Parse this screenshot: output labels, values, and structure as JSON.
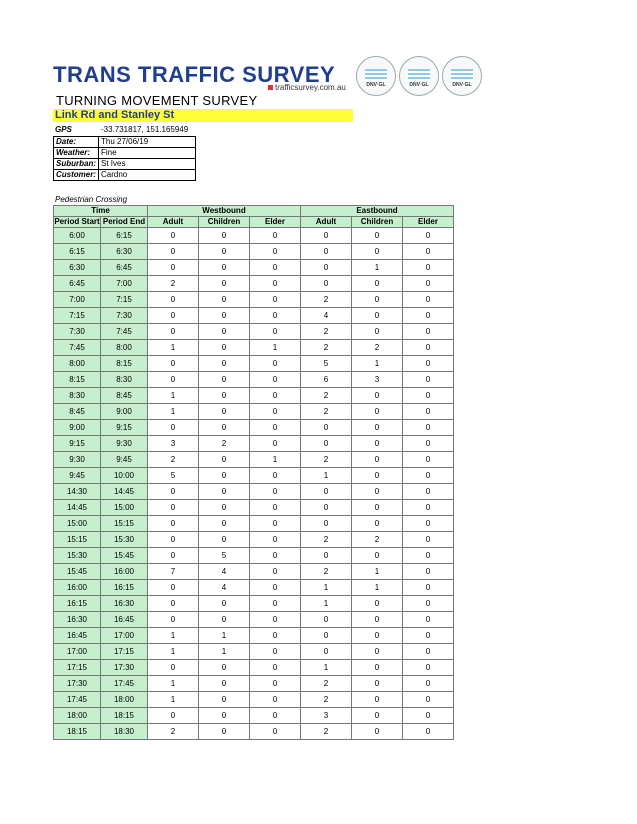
{
  "header": {
    "logo_text": "TRANS TRAFFIC SURVEY",
    "website": "trafficsurvey.com.au",
    "badges": [
      {
        "label": "DNV·GL",
        "sublabel": "ISO 9001"
      },
      {
        "label": "DNV·GL",
        "sublabel": "ISO 45001"
      },
      {
        "label": "DNV·GL",
        "sublabel": "ISO 14001"
      }
    ],
    "report_title": "TURNING MOVEMENT SURVEY",
    "location": "Link Rd and Stanley St"
  },
  "gps": {
    "label": "GPS",
    "value": "-33.731817, 151.165949"
  },
  "info": [
    {
      "label": "Date:",
      "value": "Thu 27/06/19"
    },
    {
      "label": "Weather:",
      "value": "Fine"
    },
    {
      "label": "Suburban:",
      "value": "St Ives"
    },
    {
      "label": "Customer:",
      "value": "Cardno"
    }
  ],
  "section_label": "Pedestrian Crossing",
  "table": {
    "group_headers": {
      "time": "Time",
      "westbound": "Westbound",
      "eastbound": "Eastbound"
    },
    "columns": [
      "Period Start",
      "Period End",
      "Adult",
      "Children",
      "Elder",
      "Adult",
      "Children",
      "Elder"
    ],
    "rows": [
      [
        "6:00",
        "6:15",
        "0",
        "0",
        "0",
        "0",
        "0",
        "0"
      ],
      [
        "6:15",
        "6:30",
        "0",
        "0",
        "0",
        "0",
        "0",
        "0"
      ],
      [
        "6:30",
        "6:45",
        "0",
        "0",
        "0",
        "0",
        "1",
        "0"
      ],
      [
        "6:45",
        "7:00",
        "2",
        "0",
        "0",
        "0",
        "0",
        "0"
      ],
      [
        "7:00",
        "7:15",
        "0",
        "0",
        "0",
        "2",
        "0",
        "0"
      ],
      [
        "7:15",
        "7:30",
        "0",
        "0",
        "0",
        "4",
        "0",
        "0"
      ],
      [
        "7:30",
        "7:45",
        "0",
        "0",
        "0",
        "2",
        "0",
        "0"
      ],
      [
        "7:45",
        "8:00",
        "1",
        "0",
        "1",
        "2",
        "2",
        "0"
      ],
      [
        "8:00",
        "8:15",
        "0",
        "0",
        "0",
        "5",
        "1",
        "0"
      ],
      [
        "8:15",
        "8:30",
        "0",
        "0",
        "0",
        "6",
        "3",
        "0"
      ],
      [
        "8:30",
        "8:45",
        "1",
        "0",
        "0",
        "2",
        "0",
        "0"
      ],
      [
        "8:45",
        "9:00",
        "1",
        "0",
        "0",
        "2",
        "0",
        "0"
      ],
      [
        "9:00",
        "9:15",
        "0",
        "0",
        "0",
        "0",
        "0",
        "0"
      ],
      [
        "9:15",
        "9:30",
        "3",
        "2",
        "0",
        "0",
        "0",
        "0"
      ],
      [
        "9:30",
        "9:45",
        "2",
        "0",
        "1",
        "2",
        "0",
        "0"
      ],
      [
        "9:45",
        "10:00",
        "5",
        "0",
        "0",
        "1",
        "0",
        "0"
      ],
      [
        "14:30",
        "14:45",
        "0",
        "0",
        "0",
        "0",
        "0",
        "0"
      ],
      [
        "14:45",
        "15:00",
        "0",
        "0",
        "0",
        "0",
        "0",
        "0"
      ],
      [
        "15:00",
        "15:15",
        "0",
        "0",
        "0",
        "0",
        "0",
        "0"
      ],
      [
        "15:15",
        "15:30",
        "0",
        "0",
        "0",
        "2",
        "2",
        "0"
      ],
      [
        "15:30",
        "15:45",
        "0",
        "5",
        "0",
        "0",
        "0",
        "0"
      ],
      [
        "15:45",
        "16:00",
        "7",
        "4",
        "0",
        "2",
        "1",
        "0"
      ],
      [
        "16:00",
        "16:15",
        "0",
        "4",
        "0",
        "1",
        "1",
        "0"
      ],
      [
        "16:15",
        "16:30",
        "0",
        "0",
        "0",
        "1",
        "0",
        "0"
      ],
      [
        "16:30",
        "16:45",
        "0",
        "0",
        "0",
        "0",
        "0",
        "0"
      ],
      [
        "16:45",
        "17:00",
        "1",
        "1",
        "0",
        "0",
        "0",
        "0"
      ],
      [
        "17:00",
        "17:15",
        "1",
        "1",
        "0",
        "0",
        "0",
        "0"
      ],
      [
        "17:15",
        "17:30",
        "0",
        "0",
        "0",
        "1",
        "0",
        "0"
      ],
      [
        "17:30",
        "17:45",
        "1",
        "0",
        "0",
        "2",
        "0",
        "0"
      ],
      [
        "17:45",
        "18:00",
        "1",
        "0",
        "0",
        "2",
        "0",
        "0"
      ],
      [
        "18:00",
        "18:15",
        "0",
        "0",
        "0",
        "3",
        "0",
        "0"
      ],
      [
        "18:15",
        "18:30",
        "2",
        "0",
        "0",
        "2",
        "0",
        "0"
      ]
    ]
  },
  "colors": {
    "brand_blue": "#1f3e8c",
    "header_green": "#c6efce",
    "highlight_yellow": "#ffff33"
  }
}
